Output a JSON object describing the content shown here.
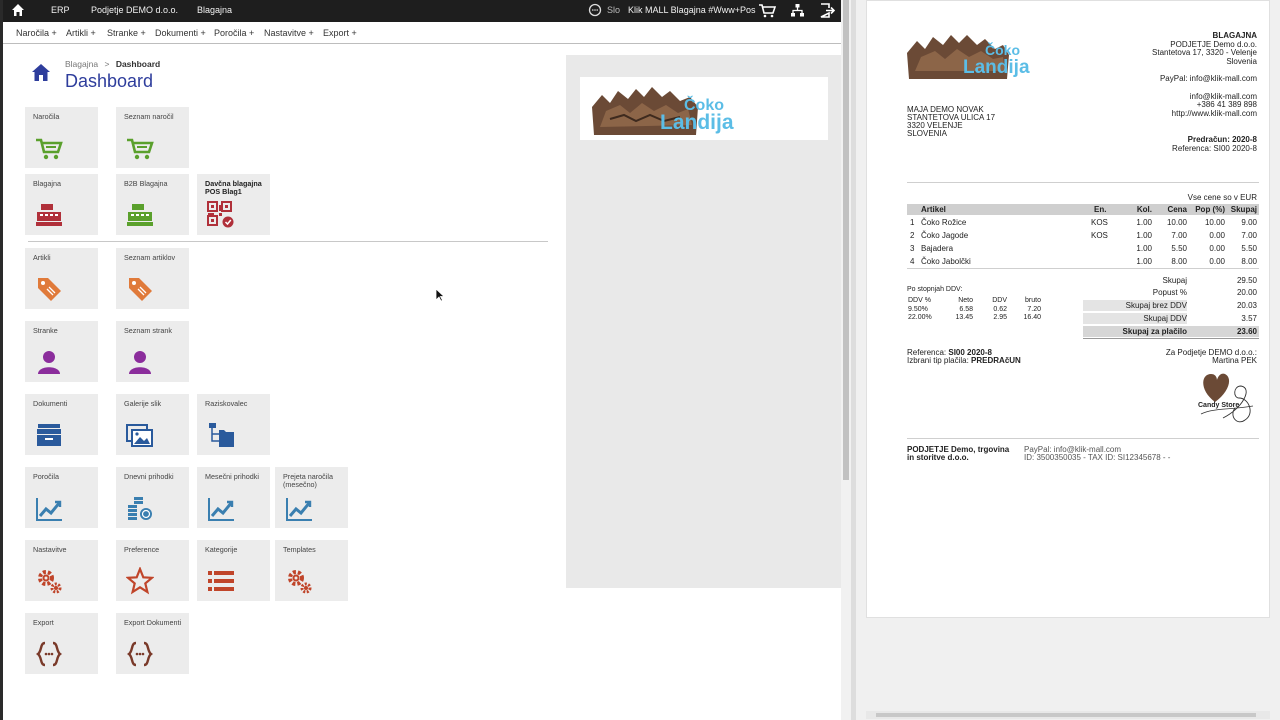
{
  "topbar": {
    "erp": "ERP",
    "company": "Podjetje DEMO d.o.o.",
    "module": "Blagajna",
    "language": "Slo",
    "shop": "Klik MALL Blagajna #Www+Pos"
  },
  "menu": [
    "Naročila +",
    "Artikli +",
    "Stranke +",
    "Dokumenti +",
    "Poročila +",
    "Nastavitve +",
    "Export +"
  ],
  "breadcrumb": {
    "parent": "Blagajna",
    "separator": ">",
    "current": "Dashboard"
  },
  "page_title": "Dashboard",
  "tiles": {
    "narocila": "Naročila",
    "seznam_narocil": "Seznam naročil",
    "blagajna": "Blagajna",
    "b2b_blagajna": "B2B Blagajna",
    "davcna_blagajna": "Davčna blagajna POS Blag1",
    "artikli": "Artikli",
    "seznam_artiklov": "Seznam artiklov",
    "stranke": "Stranke",
    "seznam_strank": "Seznam strank",
    "dokumenti": "Dokumenti",
    "galerije_slik": "Galerije slik",
    "raziskovalec": "Raziskovalec",
    "porocila": "Poročila",
    "dnevni_prihodki": "Dnevni prihodki",
    "mesecni_prihodki": "Mesečni prihodki",
    "prejeta_narocila": "Prejeta naročila (mesečno)",
    "nastavitve": "Nastavitve",
    "preference": "Preference",
    "kategorije": "Kategorije",
    "templates": "Templates",
    "export": "Export",
    "export_dokumenti": "Export Dokumenti"
  },
  "logo": {
    "line1": "Čoko",
    "line2": "Landija"
  },
  "colors": {
    "brand_blue": "#2e3d9c",
    "cart_green": "#5aa02c",
    "register_red": "#b0303a",
    "tag_orange": "#e07a3a",
    "user_purple": "#8b2d9c",
    "doc_blue": "#2a5a9c",
    "chart_blue": "#3a7fb0",
    "settings_red": "#c0452a",
    "export_brown": "#7a3a2a",
    "logo_cyan": "#5bbde6"
  },
  "invoice": {
    "seller_title": "BLAGAJNA",
    "seller_name": "PODJETJE Demo d.o.o.",
    "seller_address": "Stantetova 17, 3320 - Velenje",
    "seller_country": "Slovenia",
    "paypal": "PayPal: info@klik-mall.com",
    "email": "info@klik-mall.com",
    "phone": "+386 41 389 898",
    "web": "http://www.klik-mall.com",
    "buyer_name": "MAJA DEMO NOVAK",
    "buyer_street": "STANTETOVA ULICA 17",
    "buyer_city": "3320 VELENJE",
    "buyer_country": "SLOVENIA",
    "doc_title": "Predračun: 2020-8",
    "reference_line": "Referenca: SI00 2020-8",
    "currency_note": "Vse cene so v EUR",
    "columns": [
      "Artikel",
      "En.",
      "Kol.",
      "Cena",
      "Pop (%)",
      "Skupaj"
    ],
    "items": [
      {
        "no": "1",
        "name": "Čoko Rožice",
        "unit": "KOS",
        "qty": "1.00",
        "price": "10.00",
        "disc": "10.00",
        "total": "9.00"
      },
      {
        "no": "2",
        "name": "Čoko Jagode",
        "unit": "KOS",
        "qty": "1.00",
        "price": "7.00",
        "disc": "0.00",
        "total": "7.00"
      },
      {
        "no": "3",
        "name": "Bajadera",
        "unit": "",
        "qty": "1.00",
        "price": "5.50",
        "disc": "0.00",
        "total": "5.50"
      },
      {
        "no": "4",
        "name": "Čoko Jabolčki",
        "unit": "",
        "qty": "1.00",
        "price": "8.00",
        "disc": "0.00",
        "total": "8.00"
      }
    ],
    "vat_title": "Po stopnjah DDV:",
    "vat_columns": [
      "DDV %",
      "Neto",
      "DDV",
      "bruto"
    ],
    "vat_rows": [
      [
        "9.50%",
        "6.58",
        "0.62",
        "7.20"
      ],
      [
        "22.00%",
        "13.45",
        "2.95",
        "16.40"
      ]
    ],
    "totals": [
      {
        "label": "Skupaj",
        "value": "29.50"
      },
      {
        "label": "Popust %",
        "value": "20.00"
      },
      {
        "label": "Skupaj brez DDV",
        "value": "20.03"
      },
      {
        "label": "Skupaj DDV",
        "value": "3.57"
      },
      {
        "label": "Skupaj za plačilo",
        "value": "23.60"
      }
    ],
    "ref_label": "Referenca:",
    "ref_value": "SI00 2020-8",
    "payment_label": "Izbrani tip plačila:",
    "payment_value": "PREDRAčUN",
    "signer_for": "Za Podjetje DEMO d.o.o.:",
    "signer_name": "Martina PEK",
    "stamp_text": "Candy Store",
    "footer_company1": "PODJETJE Demo, trgovina",
    "footer_company2": "in storitve d.o.o.",
    "footer_paypal": "PayPal: info@klik-mall.com",
    "footer_ids": "ID: 3500350035 - TAX ID: SI12345678 - -"
  }
}
